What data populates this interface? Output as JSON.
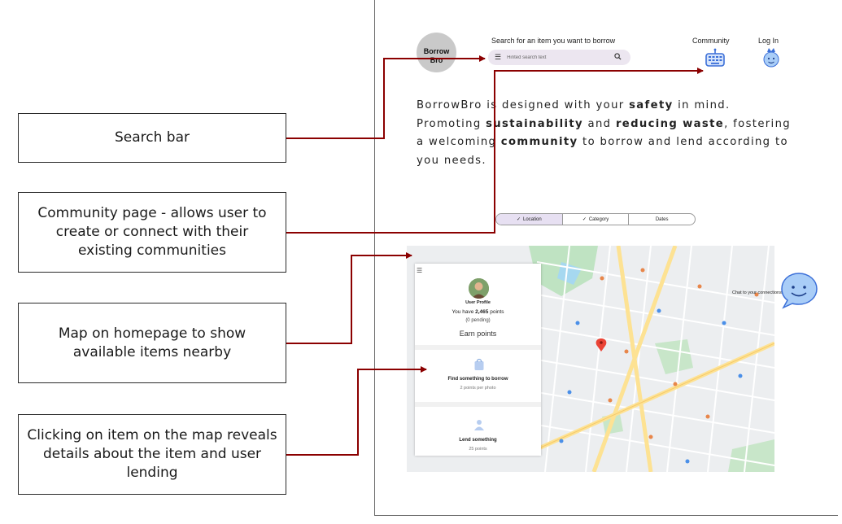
{
  "callouts": [
    {
      "text": "Search bar"
    },
    {
      "text": "Community page - allows user to create or connect with their existing communities"
    },
    {
      "text": "Map on homepage to show available items nearby"
    },
    {
      "text": "Clicking on item on the map reveals details about the item and user lending"
    }
  ],
  "app": {
    "logo": {
      "line1": "Borrow",
      "line2": "Bro"
    },
    "search": {
      "label": "Search for an item you want to borrow",
      "placeholder": "Hinted search text"
    },
    "nav": {
      "community": "Community",
      "login": "Log In"
    },
    "about": {
      "p1": "BorrowBro is designed with your ",
      "b1": "safety",
      "p2": " in mind. Promoting ",
      "b2": "sustainability",
      "p3": " and ",
      "b3": "reducing waste",
      "p4": ", fostering a welcoming ",
      "b4": "community",
      "p5": " to borrow and lend according to you needs."
    },
    "filters": [
      {
        "label": "Location",
        "checked": true
      },
      {
        "label": "Category",
        "checked": true
      },
      {
        "label": "Dates",
        "checked": false
      }
    ],
    "panel": {
      "title": "User Profile",
      "points_prefix": "You have ",
      "points": "2,465",
      "points_suffix": " points",
      "pending": "(0 pending)",
      "earn": "Earn points",
      "borrow_title": "Find something to borrow",
      "borrow_sub": "2 points per photo",
      "lend_title": "Lend something",
      "lend_sub": "25 points"
    },
    "chat": {
      "label": "Chat to your connections"
    }
  },
  "colors": {
    "accent": "#8b0000",
    "searchBar": "#ece6f0",
    "iconBlue": "#3b6fd8",
    "activeChip": "#e7e0f2"
  }
}
